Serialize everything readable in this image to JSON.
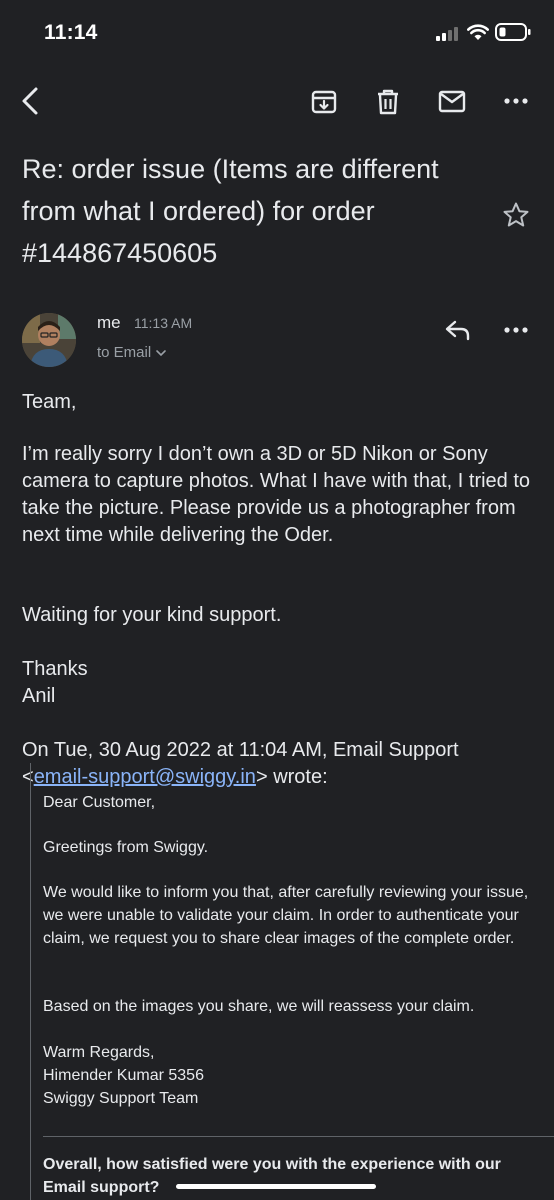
{
  "status_bar": {
    "time": "11:14"
  },
  "toolbar": {
    "back_icon": "chevron-left-icon",
    "archive_icon": "archive-icon",
    "delete_icon": "trash-icon",
    "mark_unread_icon": "mail-icon",
    "more_icon": "more-horizontal-icon"
  },
  "email": {
    "subject": "Re: order issue (Items are different from what I ordered) for order #144867450605",
    "sender": "me",
    "time": "11:13 AM",
    "to": "to Email",
    "body": {
      "greeting": "Team,",
      "paragraph": "I’m really sorry I don’t own a 3D or 5D Nikon or Sony camera to capture photos. What I have with that, I tried to take the picture. Please provide us a photographer from next time while delivering the Oder.",
      "closing": "Waiting for your kind support.",
      "thanks": "Thanks",
      "name": "Anil"
    },
    "quote_header_prefix": "On Tue, 30 Aug 2022 at 11:04 AM, Email Support",
    "quote_header_email": "email-support@swiggy.in",
    "quote_header_suffix": "wrote:",
    "quoted": {
      "salutation": "Dear Customer,",
      "greeting": "Greetings from Swiggy.",
      "paragraph1": "We would like to inform you that, after carefully reviewing your issue, we were unable to validate your claim. In order to authenticate your claim, we request you to share clear images of the complete order.",
      "paragraph2": "Based on the images you share, we will reassess your claim.",
      "signoff": "Warm Regards,",
      "agent": "Himender Kumar 5356",
      "team": "Swiggy Support Team",
      "survey": "Overall, how satisfied were you with the experience with our Email support?"
    }
  }
}
